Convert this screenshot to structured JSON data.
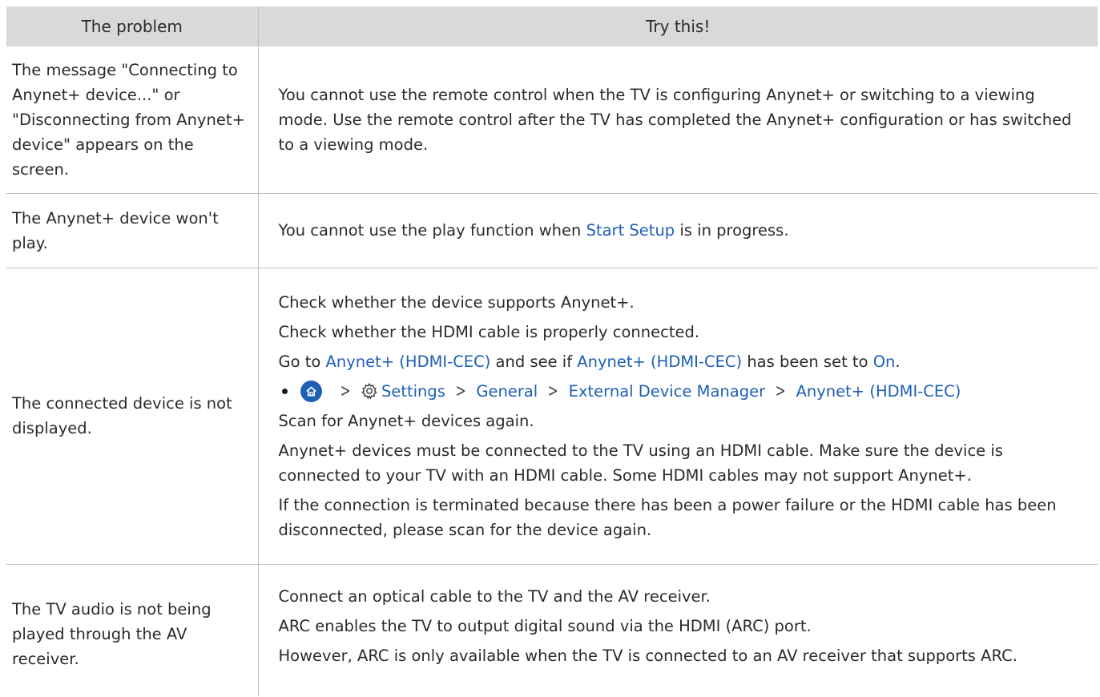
{
  "headers": {
    "problem": "The problem",
    "solution": "Try this!"
  },
  "rows": [
    {
      "problem": "The message \"Connecting to Anynet+ device...\" or \"Disconnecting from Anynet+ device\" appears on the screen.",
      "solution": "You cannot use the remote control when the TV is configuring Anynet+ or switching to a viewing mode. Use the remote control after the TV has completed the Anynet+ configuration or has switched to a viewing mode."
    },
    {
      "problem": "The Anynet+ device won't play.",
      "solution_pre": "You cannot use the play function when ",
      "solution_link": "Start Setup",
      "solution_post": " is in progress."
    },
    {
      "problem": "The connected device is not displayed.",
      "p1": "Check whether the device supports Anynet+.",
      "p2": "Check whether the HDMI cable is properly connected.",
      "p3_pre": "Go to ",
      "p3_link1": "Anynet+ (HDMI-CEC)",
      "p3_mid": " and see if ",
      "p3_link2": "Anynet+ (HDMI-CEC)",
      "p3_mid2": " has been set to ",
      "p3_link3": "On",
      "p3_post": ".",
      "path": {
        "icons": [
          "home-icon",
          "gear-icon"
        ],
        "settings": "Settings",
        "general": "General",
        "edm": "External Device Manager",
        "anynet": "Anynet+ (HDMI-CEC)"
      },
      "p4": "Scan for Anynet+ devices again.",
      "p5": "Anynet+ devices must be connected to the TV using an HDMI cable. Make sure the device is connected to your TV with an HDMI cable. Some HDMI cables may not support Anynet+.",
      "p6": "If the connection is terminated because there has been a power failure or the HDMI cable has been disconnected, please scan for the device again."
    },
    {
      "problem": "The TV audio is not being played through the AV receiver.",
      "p1": "Connect an optical cable to the TV and the AV receiver.",
      "p2": "ARC enables the TV to output digital sound via the HDMI (ARC) port.",
      "p3": "However, ARC is only available when the TV is connected to an AV receiver that supports ARC."
    }
  ],
  "colors": {
    "header_bg": "#d9d9d9",
    "link": "#1f5fb5",
    "border": "#bfbfbf"
  }
}
